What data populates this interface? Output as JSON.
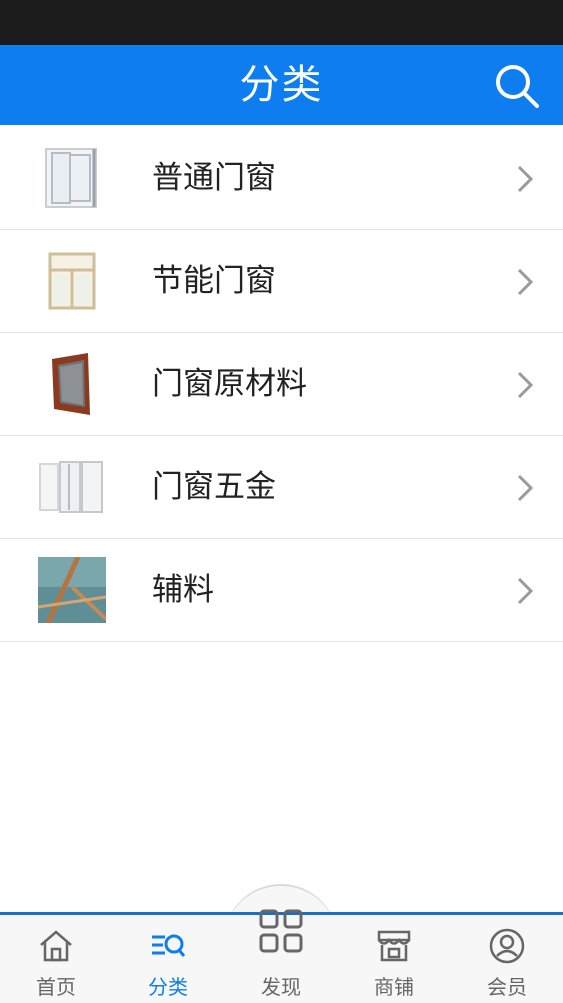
{
  "header": {
    "title": "分类",
    "search_icon": "search-icon"
  },
  "categories": [
    {
      "label": "普通门窗",
      "thumb": "sliding-window-image"
    },
    {
      "label": "节能门窗",
      "thumb": "energy-saving-window-image"
    },
    {
      "label": "门窗原材料",
      "thumb": "window-frame-profile-image"
    },
    {
      "label": "门窗五金",
      "thumb": "window-panels-image"
    },
    {
      "label": "辅料",
      "thumb": "window-accessories-image"
    }
  ],
  "tabbar": {
    "tabs": [
      {
        "label": "首页",
        "icon": "home-icon"
      },
      {
        "label": "分类",
        "icon": "category-icon",
        "active": true
      },
      {
        "label": "发现",
        "icon": "grid-icon"
      },
      {
        "label": "商铺",
        "icon": "shop-icon"
      },
      {
        "label": "会员",
        "icon": "user-icon"
      }
    ]
  },
  "colors": {
    "accent": "#0d7df0",
    "status_bar": "#1b1b1b",
    "divider": "#e3e3e3"
  }
}
